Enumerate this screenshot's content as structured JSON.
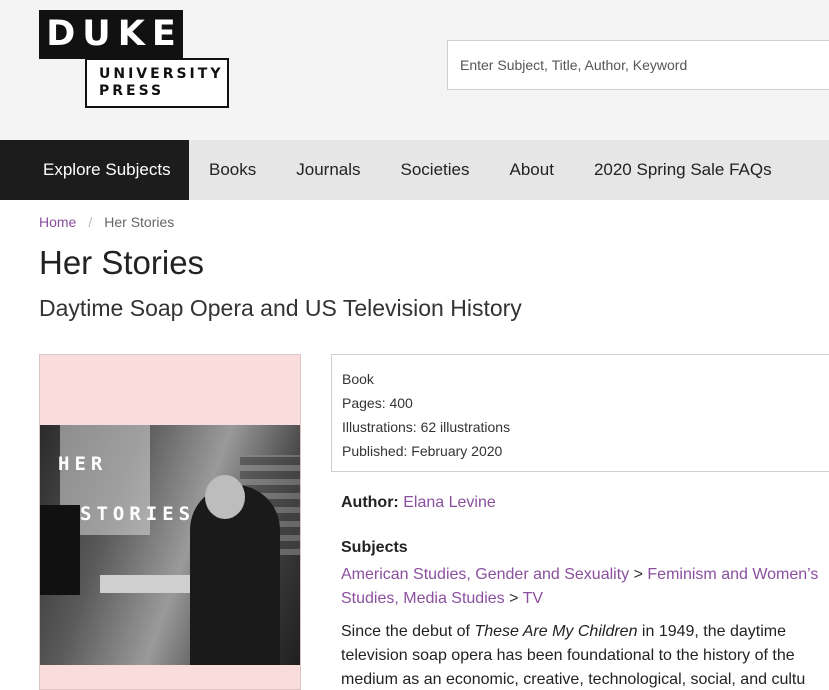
{
  "logo": {
    "line1": "DUKE",
    "line2": "UNIVERSITY",
    "line3": "PRESS"
  },
  "search": {
    "placeholder": "Enter Subject, Title, Author, Keyword"
  },
  "nav": [
    "Explore Subjects",
    "Books",
    "Journals",
    "Societies",
    "About",
    "2020 Spring Sale FAQs"
  ],
  "breadcrumb": {
    "home": "Home",
    "separator": "/",
    "current": "Her Stories"
  },
  "book": {
    "title": "Her Stories",
    "subtitle": "Daytime Soap Opera and US Television History",
    "cover": {
      "line1": "HER",
      "line2": "STORIES"
    },
    "info": [
      "Book",
      "Pages: 400",
      "Illustrations: 62 illustrations",
      "Published: February 2020"
    ],
    "author_label": "Author:",
    "author": "Elana Levine",
    "subjects_heading": "Subjects",
    "subjects": {
      "s1": "American Studies, Gender and Sexuality",
      "s2": "Feminism and Women’s Studies, Media Studies",
      "s3": "TV",
      "gt": ">"
    },
    "description": {
      "l1a": "Since the debut of ",
      "l1i": "These Are My Children",
      "l1b": " in 1949, the daytime",
      "l2": "television soap opera has been foundational to the history of the",
      "l3": "medium as an economic, creative, technological, social, and cultu"
    }
  }
}
